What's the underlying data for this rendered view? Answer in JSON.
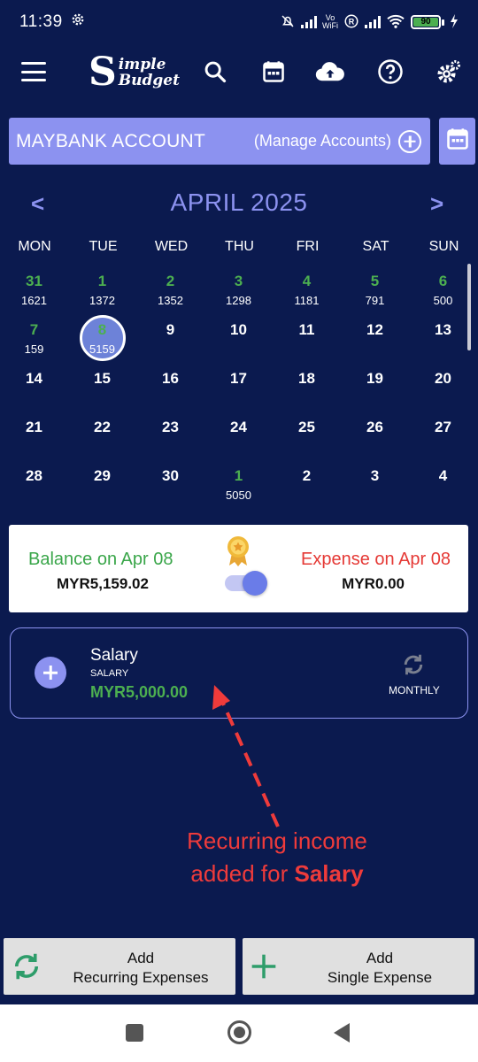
{
  "status_bar": {
    "time": "11:39",
    "battery": "90"
  },
  "app": {
    "logo_initial": "S",
    "logo_word1": "imple",
    "logo_word2": "Budget"
  },
  "account": {
    "name": "MAYBANK ACCOUNT",
    "manage_label": "(Manage Accounts)"
  },
  "calendar": {
    "month_title": "APRIL 2025",
    "prev": "<",
    "next": ">",
    "weekdays": [
      "MON",
      "TUE",
      "WED",
      "THU",
      "FRI",
      "SAT",
      "SUN"
    ],
    "weeks": [
      [
        {
          "d": "31",
          "v": "1621",
          "g": true
        },
        {
          "d": "1",
          "v": "1372",
          "g": true
        },
        {
          "d": "2",
          "v": "1352",
          "g": true
        },
        {
          "d": "3",
          "v": "1298",
          "g": true
        },
        {
          "d": "4",
          "v": "1181",
          "g": true
        },
        {
          "d": "5",
          "v": "791",
          "g": true
        },
        {
          "d": "6",
          "v": "500",
          "g": true
        }
      ],
      [
        {
          "d": "7",
          "v": "159",
          "g": true
        },
        {
          "d": "8",
          "v": "5159",
          "g": true,
          "sel": true
        },
        {
          "d": "9",
          "v": ""
        },
        {
          "d": "10",
          "v": ""
        },
        {
          "d": "11",
          "v": ""
        },
        {
          "d": "12",
          "v": ""
        },
        {
          "d": "13",
          "v": ""
        }
      ],
      [
        {
          "d": "14",
          "v": ""
        },
        {
          "d": "15",
          "v": ""
        },
        {
          "d": "16",
          "v": ""
        },
        {
          "d": "17",
          "v": ""
        },
        {
          "d": "18",
          "v": ""
        },
        {
          "d": "19",
          "v": ""
        },
        {
          "d": "20",
          "v": ""
        }
      ],
      [
        {
          "d": "21",
          "v": ""
        },
        {
          "d": "22",
          "v": ""
        },
        {
          "d": "23",
          "v": ""
        },
        {
          "d": "24",
          "v": ""
        },
        {
          "d": "25",
          "v": ""
        },
        {
          "d": "26",
          "v": ""
        },
        {
          "d": "27",
          "v": ""
        }
      ],
      [
        {
          "d": "28",
          "v": ""
        },
        {
          "d": "29",
          "v": ""
        },
        {
          "d": "30",
          "v": ""
        },
        {
          "d": "1",
          "v": "5050",
          "g": true
        },
        {
          "d": "2",
          "v": ""
        },
        {
          "d": "3",
          "v": ""
        },
        {
          "d": "4",
          "v": ""
        }
      ]
    ]
  },
  "summary": {
    "balance_label": "Balance on Apr 08",
    "balance_value": "MYR5,159.02",
    "expense_label": "Expense on Apr 08",
    "expense_value": "MYR0.00"
  },
  "recurring_item": {
    "title": "Salary",
    "category": "SALARY",
    "amount": "MYR5,000.00",
    "frequency": "MONTHLY"
  },
  "annotation": {
    "line1": "Recurring income",
    "line2_prefix": "added for ",
    "line2_bold": "Salary"
  },
  "buttons": {
    "recurring_line1": "Add",
    "recurring_line2": "Recurring Expenses",
    "single_line1": "Add",
    "single_line2": "Single Expense"
  },
  "colors": {
    "background": "#0b1a4f",
    "accent": "#8c92f0",
    "green": "#4caf50",
    "red": "#e53935"
  }
}
